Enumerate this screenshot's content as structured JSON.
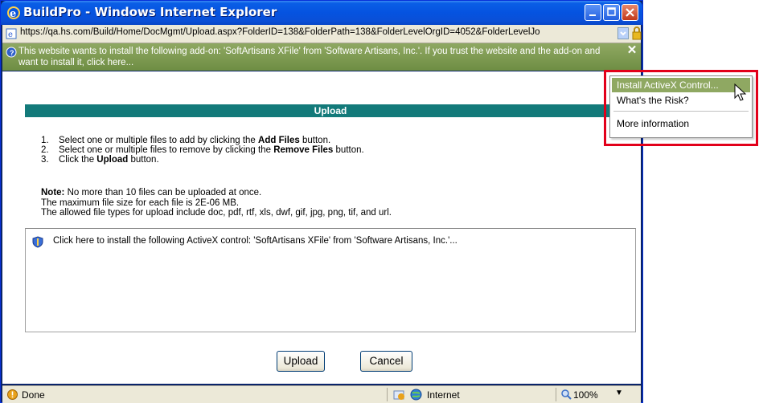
{
  "window": {
    "title": "BuildPro - Windows Internet Explorer",
    "address": "https://qa.hs.com/Build/Home/DocMgmt/Upload.aspx?FolderID=138&FolderPath=138&FolderLevelOrgID=4052&FolderLevelJo"
  },
  "infobar": {
    "text": "This website wants to install the following add-on: 'SoftArtisans XFile' from 'Software Artisans, Inc.'. If you trust the website and the add-on and want to install it, click here...",
    "close": "✕"
  },
  "upload": {
    "header": "Upload",
    "steps": [
      {
        "num": "1.",
        "pre": "Select one or multiple files to add by clicking the ",
        "bold": "Add Files",
        "post": " button."
      },
      {
        "num": "2.",
        "pre": "Select one or multiple files to remove by clicking the ",
        "bold": "Remove Files",
        "post": " button."
      },
      {
        "num": "3.",
        "pre": "Click the ",
        "bold": "Upload",
        "post": " button."
      }
    ],
    "note_label": "Note:",
    "note_text": " No more than 10 files can be uploaded at once.",
    "max_size": "The maximum file size for each file is 2E-06 MB.",
    "allowed_types": "The allowed file types for upload include doc, pdf, rtf, xls, dwf, gif, jpg, png, tif, and url.",
    "activex_text": "Click here to install the following ActiveX control: 'SoftArtisans XFile' from 'Software Artisans, Inc.'...",
    "upload_button": "Upload",
    "cancel_button": "Cancel"
  },
  "status": {
    "text": "Done",
    "zone": "Internet",
    "zoom": "100%",
    "zoom_arrow": "▼"
  },
  "menu": {
    "items": [
      "Install ActiveX Control...",
      "What's the Risk?",
      "More information"
    ]
  },
  "colors": {
    "header_teal": "#137a7a",
    "infobar_green": "#8fa862",
    "highlight_red": "#e2001a",
    "titlebar_blue": "#0553e0"
  },
  "icons": [
    "ie-icon",
    "minimize-icon",
    "maximize-icon",
    "close-icon",
    "page-icon",
    "dropdown-icon",
    "lock-icon",
    "info-icon",
    "shield-icon",
    "warning-icon",
    "globe-icon",
    "zoom-icon",
    "cursor-icon"
  ]
}
